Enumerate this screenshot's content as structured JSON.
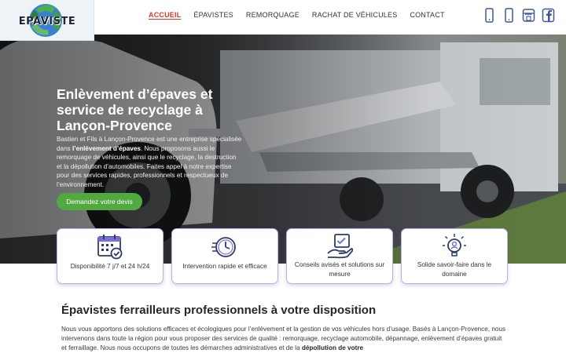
{
  "logo": {
    "text": "EPAVISTE",
    "icon": "recycle-globe-logo"
  },
  "nav": {
    "items": [
      {
        "label": "ACCUEIL",
        "active": true
      },
      {
        "label": "ÉPAVISTES"
      },
      {
        "label": "REMORQUAGE"
      },
      {
        "label": "RACHAT DE VÉHICULES"
      },
      {
        "label": "CONTACT"
      }
    ]
  },
  "social": {
    "icons": [
      "mobile-phone-icon",
      "mobile-phone-icon",
      "store-icon",
      "facebook-icon"
    ],
    "accent": "#3b5998"
  },
  "hero": {
    "title": "Enlèvement d’épaves et service de recyclage à Lançon-Provence",
    "text_1": "Bastien et Fils à Lançon-Provence est une entreprise spécialisée dans ",
    "text_bold": "l’enlèvement d’épaves",
    "text_2": ". Nous proposons aussi le remorquage de véhicules, ainsi que le recyclage, la destruction et la dépollution d’automobiles. Faites appel à notre expertise pour des services rapides, professionnels et respectueux de l’environnement.",
    "cta": "Demandez votre devis",
    "cta_color": "#52a93f"
  },
  "cards": [
    {
      "label": "Disponibilité 7 j/7 et 24 h/24",
      "icon": "calendar-check-icon"
    },
    {
      "label": "Intervention rapide et efficace",
      "icon": "stopwatch-icon"
    },
    {
      "label": "Conseils avisés et solutions sur mesure",
      "icon": "hand-document-icon"
    },
    {
      "label": "Solide savoir-faire dans le domaine",
      "icon": "lightbulb-person-icon"
    }
  ],
  "section": {
    "title": "Épavistes ferrailleurs professionnels à votre disposition",
    "text_1": "Nous vous apportons des solutions efficaces et écologiques pour l’enlèvement et la gestion de vos véhicules hors d’usage. Basés à Lançon-Provence, nous intervenons dans toute la région pour vous proposer des services de qualité : remorquage, recyclage automobile, dépannage, enlèvement d’épaves gratuit et ferraillage. Nous nous occupons de toutes les démarches administratives et de la ",
    "text_bold": "dépollution de votre"
  },
  "colors": {
    "accent_red": "#d23b2a",
    "card_border": "#b8b2ea",
    "icon_navy": "#2f3b6b"
  }
}
